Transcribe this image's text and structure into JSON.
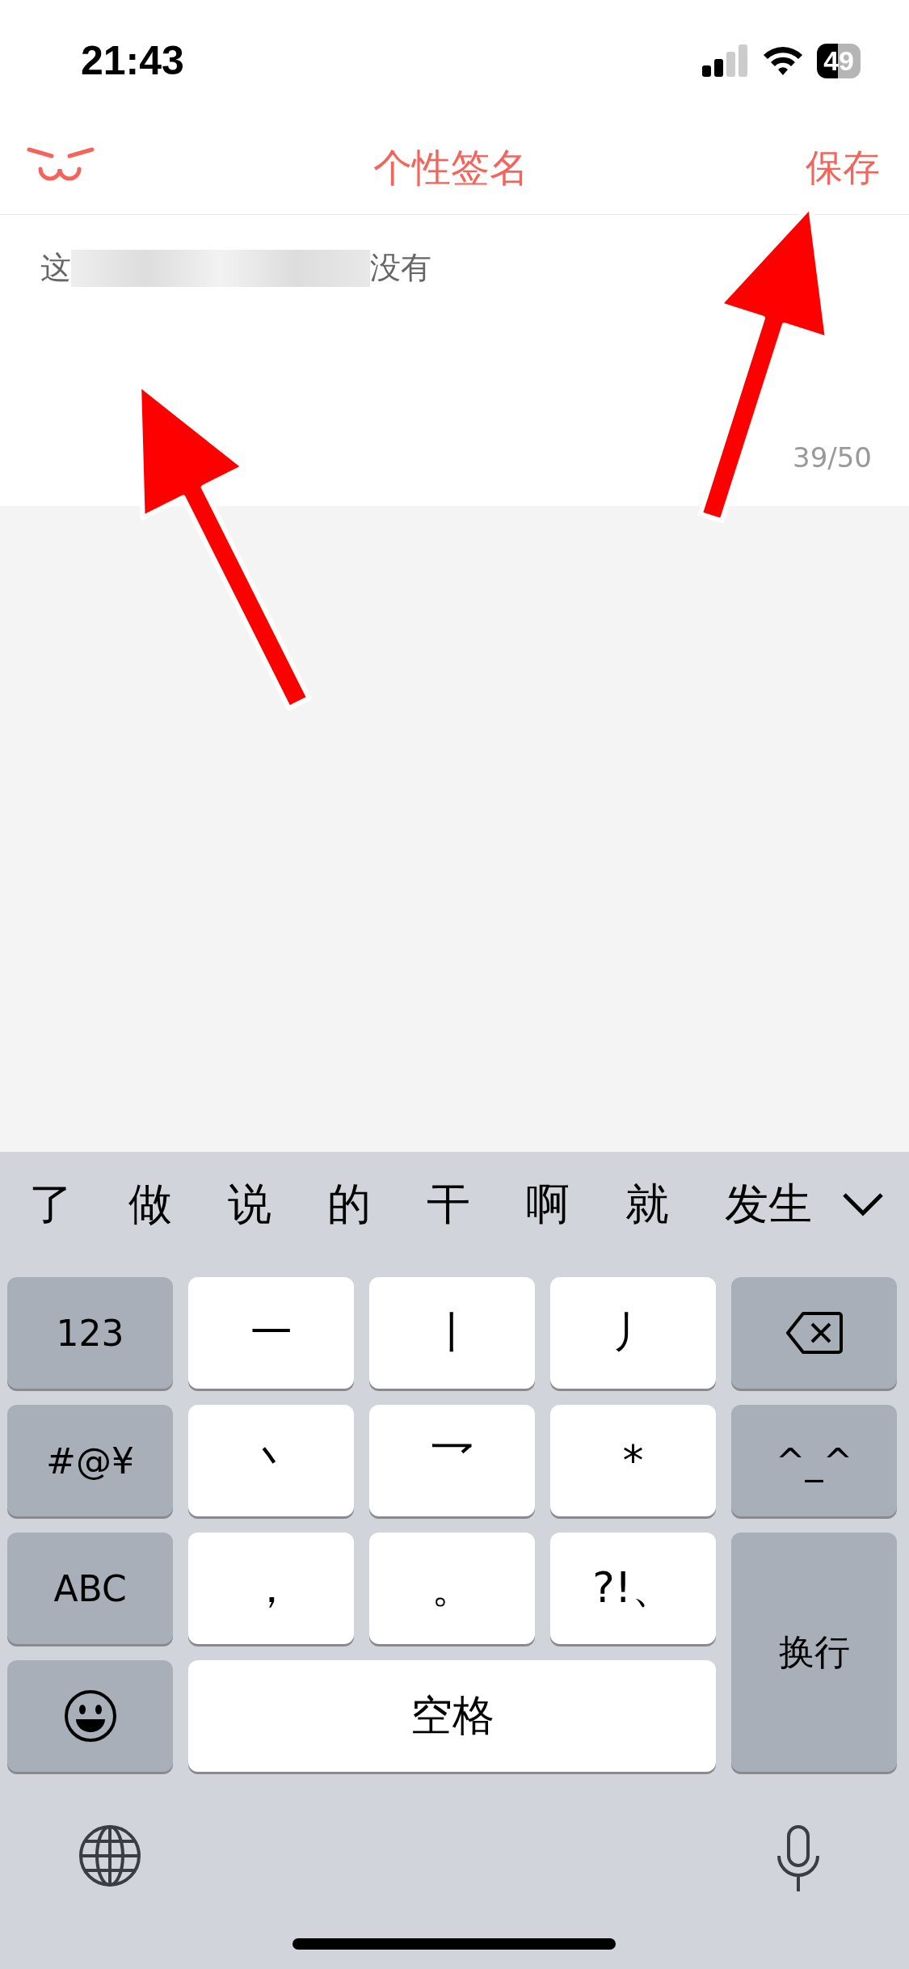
{
  "status_bar": {
    "time": "21:43",
    "battery": "49"
  },
  "nav": {
    "title": "个性签名",
    "action": "保存"
  },
  "editor": {
    "text_start": "这",
    "text_end": "没有",
    "counter": "39/50"
  },
  "keyboard": {
    "candidates": [
      "了",
      "做",
      "说",
      "的",
      "干",
      "啊",
      "就",
      "发生"
    ],
    "keys": [
      {
        "kind": "function",
        "label": "123"
      },
      {
        "kind": "char",
        "label": "一"
      },
      {
        "kind": "char",
        "label": "丨"
      },
      {
        "kind": "char",
        "label": "丿"
      },
      {
        "kind": "delete"
      },
      {
        "kind": "function",
        "label": "#@¥"
      },
      {
        "kind": "char",
        "label": "丶"
      },
      {
        "kind": "char",
        "label": "乛"
      },
      {
        "kind": "char",
        "label": "*"
      },
      {
        "kind": "function",
        "label": "^_^"
      },
      {
        "kind": "function",
        "label": "ABC"
      },
      {
        "kind": "char",
        "label": "，"
      },
      {
        "kind": "char",
        "label": "。"
      },
      {
        "kind": "char",
        "label": "?!、"
      },
      {
        "kind": "return",
        "label": "换行"
      },
      {
        "kind": "emoji"
      },
      {
        "kind": "space",
        "label": "空格"
      }
    ]
  }
}
